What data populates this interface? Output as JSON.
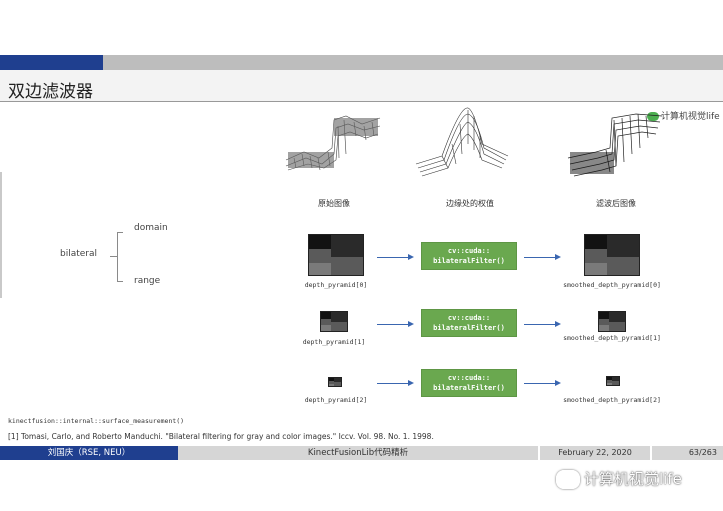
{
  "header": {
    "title": "双边滤波器"
  },
  "watermark": {
    "top_text": "计算机视觉life",
    "bottom_text": "计算机视觉life"
  },
  "figures": {
    "captions": [
      "原始图像",
      "边缘处的权值",
      "滤波后图像"
    ]
  },
  "tree": {
    "root": "bilateral",
    "children": [
      "domain",
      "range"
    ]
  },
  "pipeline": {
    "filter_label_line1": "cv::cuda::",
    "filter_label_line2": "bilateralFilter()",
    "rows": [
      {
        "input": "depth_pyramid[0]",
        "output": "smoothed_depth_pyramid[0]"
      },
      {
        "input": "depth_pyramid[1]",
        "output": "smoothed_depth_pyramid[1]"
      },
      {
        "input": "depth_pyramid[2]",
        "output": "smoothed_depth_pyramid[2]"
      }
    ]
  },
  "code_ref": "kinectfusion::internal::surface_measurement()",
  "reference": "[1] Tomasi, Carlo, and Roberto Manduchi. \"Bilateral filtering for gray and color images.\" Iccv. Vol. 98. No. 1. 1998.",
  "footer": {
    "author": "刘国庆（RSE, NEU）",
    "title": "KinectFusionLib代码精析",
    "date": "February 22, 2020",
    "page": "63/263"
  },
  "colors": {
    "blue_bar": "#1f3f8f",
    "green_box": "#6aa84f",
    "arrow": "#3a66b0"
  }
}
